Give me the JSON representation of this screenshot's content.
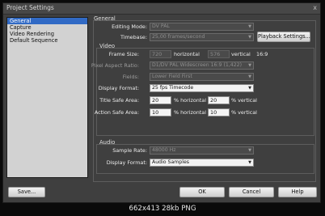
{
  "window": {
    "title": "Project Settings",
    "close_glyph": "x"
  },
  "sidebar": {
    "items": [
      {
        "label": "General"
      },
      {
        "label": "Capture"
      },
      {
        "label": "Video Rendering"
      },
      {
        "label": "Default Sequence"
      }
    ]
  },
  "general": {
    "heading": "General",
    "editing_mode_label": "Editing Mode:",
    "editing_mode_value": "DV PAL",
    "timebase_label": "Timebase:",
    "timebase_value": "25,00 frames/second",
    "playback_button": "Playback Settings..."
  },
  "video": {
    "heading": "Video",
    "frame_size_label": "Frame Size:",
    "frame_width": "720",
    "horizontal_label": "horizontal",
    "frame_height": "576",
    "vertical_label": "vertical",
    "aspect": "16:9",
    "pixel_aspect_label": "Pixel Aspect Ratio:",
    "pixel_aspect_value": "D1/DV PAL Widescreen 16:9 (1,422)",
    "fields_label": "Fields:",
    "fields_value": "Lower Field First",
    "display_format_label": "Display Format:",
    "display_format_value": "25 fps Timecode",
    "title_safe_label": "Title Safe Area:",
    "title_safe_h": "20",
    "title_safe_v": "20",
    "action_safe_label": "Action Safe Area:",
    "action_safe_h": "10",
    "action_safe_v": "10",
    "pct_horizontal": "% horizontal",
    "pct_vertical": "% vertical"
  },
  "audio": {
    "heading": "Audio",
    "sample_rate_label": "Sample Rate:",
    "sample_rate_value": "48000 Hz",
    "display_format_label": "Display Format:",
    "display_format_value": "Audio Samples"
  },
  "buttons": {
    "save": "Save...",
    "ok": "OK",
    "cancel": "Cancel",
    "help": "Help"
  },
  "caption": "662x413 28kb PNG",
  "icons": {
    "dropdown": "chevron-down-icon",
    "close": "close-icon"
  }
}
